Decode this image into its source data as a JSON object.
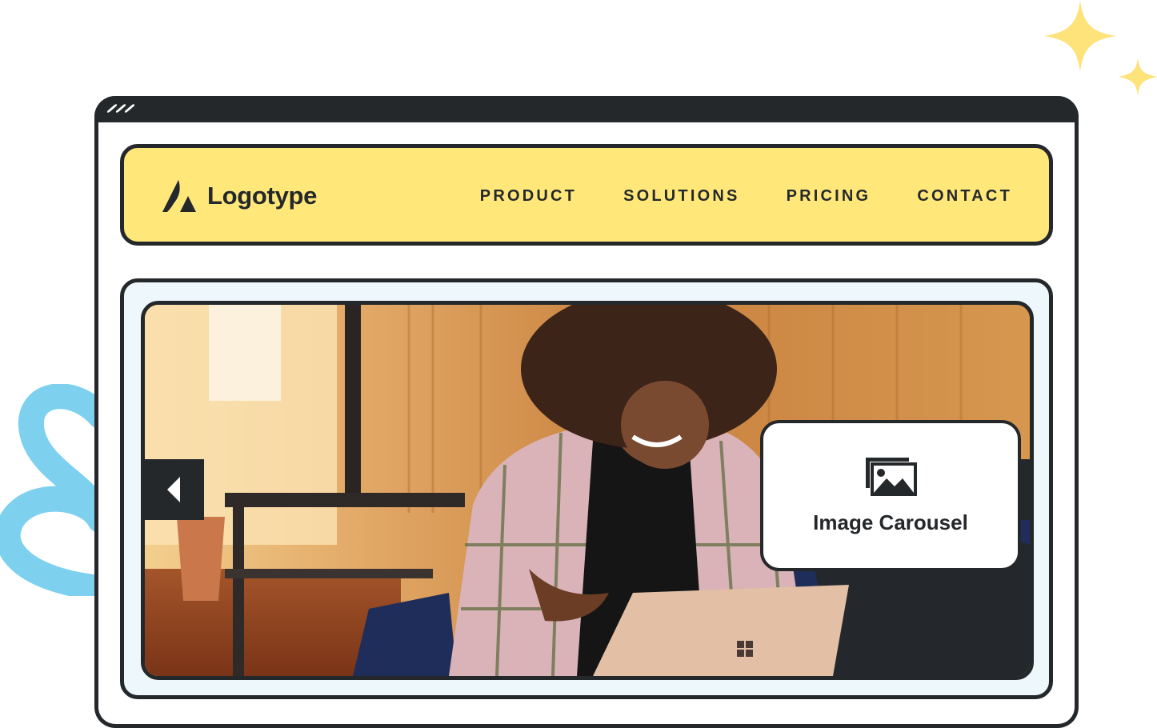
{
  "browser": {
    "window_dots": 3
  },
  "navbar": {
    "logo_text": "Logotype",
    "items": [
      {
        "label": "PRODUCT"
      },
      {
        "label": "SOLUTIONS"
      },
      {
        "label": "PRICING"
      },
      {
        "label": "CONTACT"
      }
    ]
  },
  "carousel": {
    "slide_description": "Woman with curly hair in plaid jacket smiling at laptop on blue couch",
    "prev_icon": "triangle-left-icon",
    "next_icon": "triangle-right-icon"
  },
  "badge": {
    "icon": "image-gallery-icon",
    "label": "Image Carousel"
  },
  "colors": {
    "navbar_bg": "#ffe879",
    "outline": "#25282b",
    "carousel_bg": "#eef8fc",
    "sparkle": "#fee27a",
    "squiggle": "#7dd0ee"
  }
}
